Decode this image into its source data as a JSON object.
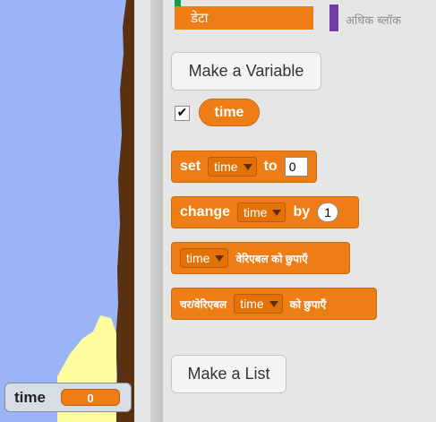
{
  "stage_monitor": {
    "label": "time",
    "value": "0"
  },
  "categories": {
    "data_label": "डेटा",
    "more_blocks_label": "अधिक ब्लॉक"
  },
  "buttons": {
    "make_variable": "Make a Variable",
    "make_list": "Make a List"
  },
  "variable": {
    "name": "time",
    "checked": true,
    "checkbox_glyph": "✔"
  },
  "blocks": {
    "set": {
      "label": "set",
      "var": "time",
      "to_label": "to",
      "value": "0"
    },
    "change": {
      "label": "change",
      "var": "time",
      "by_label": "by",
      "value": "1"
    },
    "hide_var": {
      "var": "time",
      "label": "वेरिएबल को छुपाएँ"
    },
    "show_var": {
      "label": "चर/वेरिएबल",
      "var": "time",
      "suffix": "को छुपाएँ"
    }
  },
  "colors": {
    "stage_sky": "#9bb4f7",
    "data_orange": "#ee7d16",
    "more_blocks_purple": "#6f3fa3",
    "palette_bg": "#e6e6e6"
  }
}
